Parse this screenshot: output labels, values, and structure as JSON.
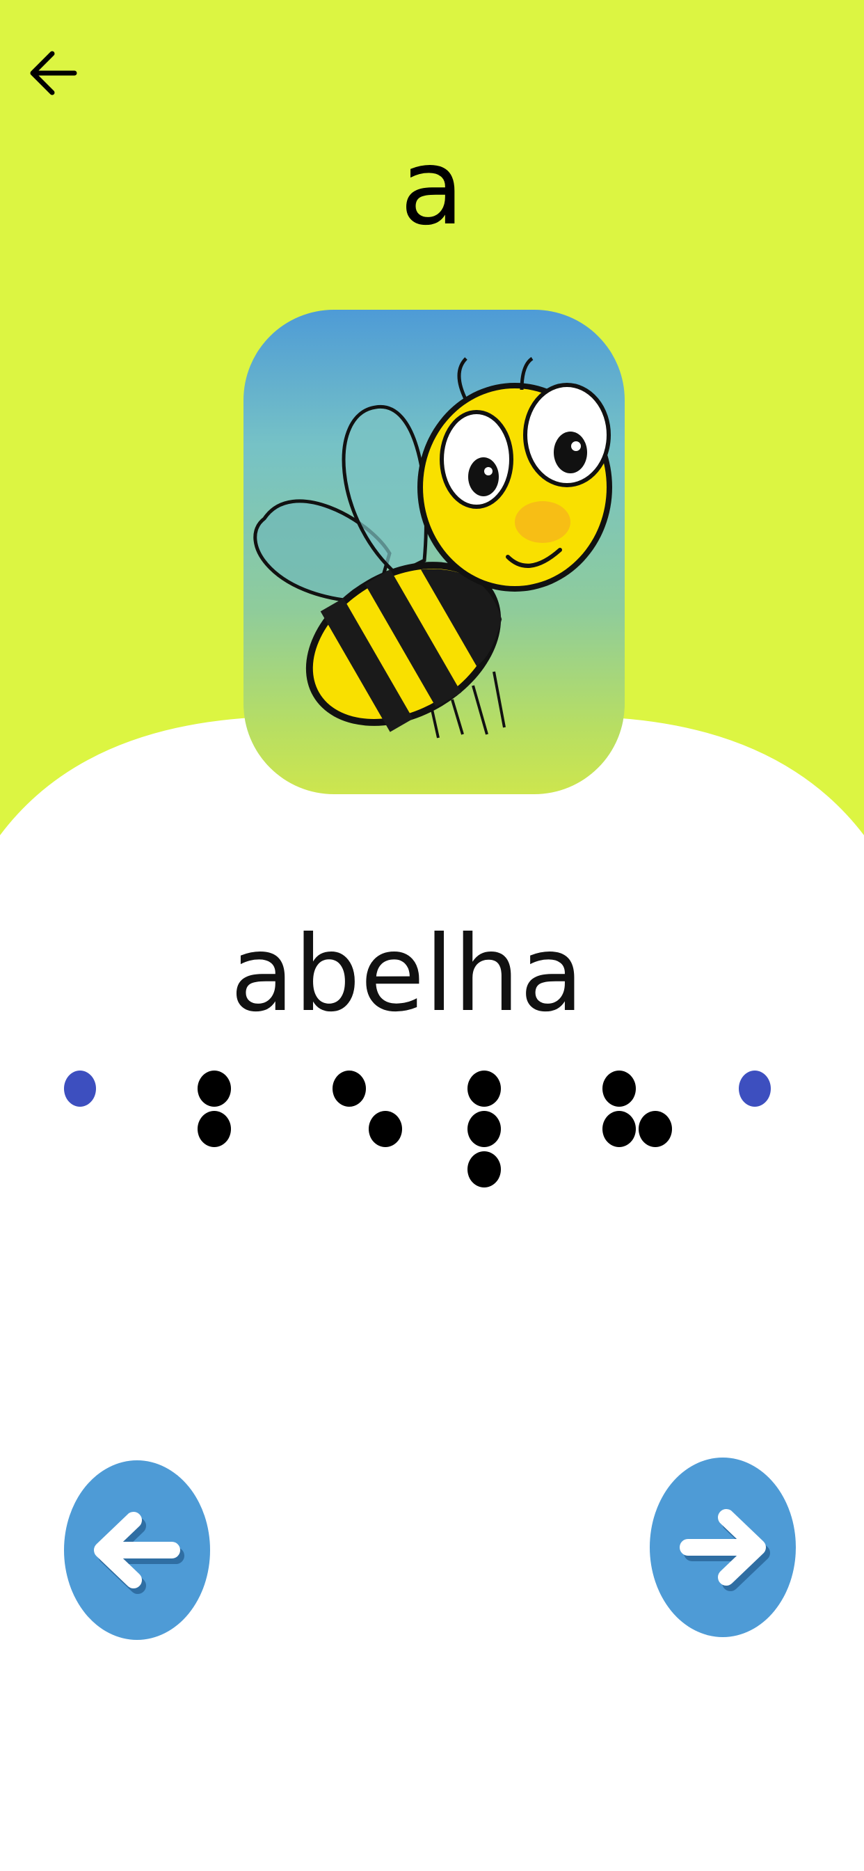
{
  "header": {
    "back_icon": "arrow-left-icon",
    "letter": "a",
    "background_color": "#dcf542"
  },
  "card": {
    "image": "bee-illustration",
    "word": "abelha"
  },
  "braille": {
    "marker_color": "#3d4fbf",
    "cells": [
      {
        "letter": "a",
        "dots": [
          1
        ]
      },
      {
        "letter": "b",
        "dots": [
          1,
          2
        ]
      },
      {
        "letter": "e",
        "dots": [
          1,
          5
        ]
      },
      {
        "letter": "l",
        "dots": [
          1,
          2,
          3
        ]
      },
      {
        "letter": "h",
        "dots": [
          1,
          2,
          5
        ]
      },
      {
        "letter": "a",
        "dots": [
          1
        ]
      }
    ]
  },
  "navigation": {
    "prev_icon": "arrow-left-icon",
    "next_icon": "arrow-right-icon",
    "button_color": "#4e9bd6"
  }
}
